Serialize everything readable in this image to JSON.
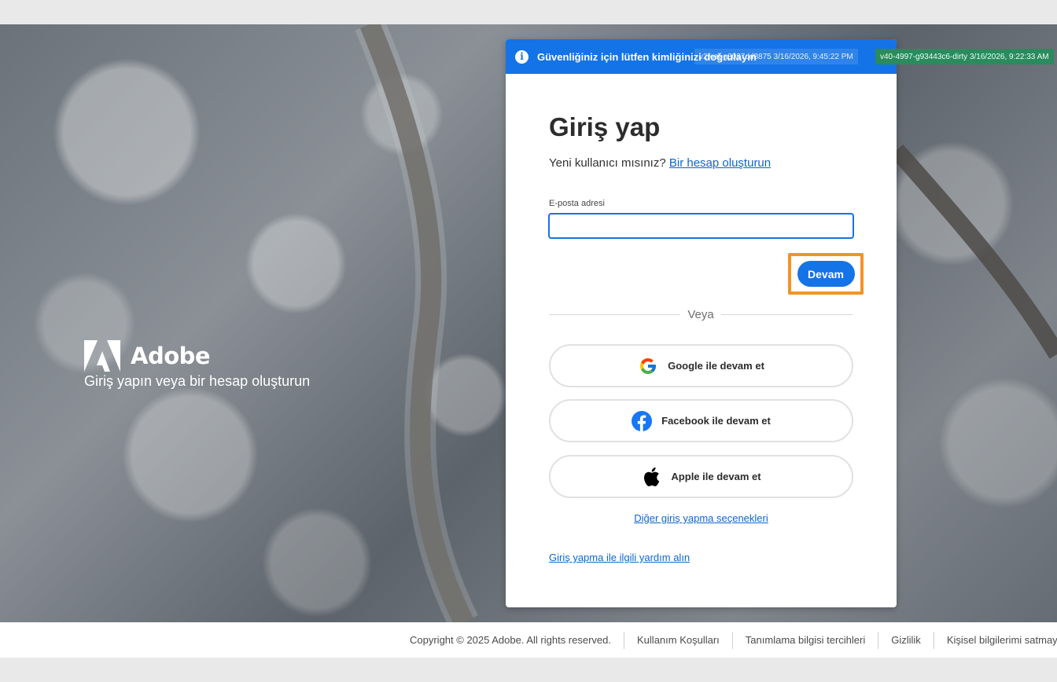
{
  "banner": {
    "text": "Güvenliğiniz için lütfen kimliğinizi doğrulayın",
    "version_a": "v2rozt-g3037dd8875 3/16/2026, 9:45:22 PM",
    "version_b": "v40-4997-g93443c6-dirty 3/16/2026, 9:22:33 AM",
    "color": "#1473e6"
  },
  "brand": {
    "name": "Adobe",
    "tagline": "Giriş yapın veya bir hesap oluşturun",
    "logo_icon": "adobe-logo-icon"
  },
  "form": {
    "title": "Giriş yap",
    "new_user_text": "Yeni kullanıcı mısınız?",
    "create_account_link": "Bir hesap oluşturun",
    "email_label": "E-posta adresi",
    "email_value": "",
    "continue_label": "Devam",
    "or_text": "Veya",
    "accent_color": "#1473e6",
    "highlight_color": "#f29423"
  },
  "social": {
    "google": "Google ile devam et",
    "facebook": "Facebook ile devam et",
    "apple": "Apple ile devam et"
  },
  "links": {
    "other_options": "Diğer giriş yapma seçenekleri",
    "help": "Giriş yapma ile ilgili yardım alın"
  },
  "footer": {
    "copyright": "Copyright © 2025 Adobe. All rights reserved.",
    "terms": "Kullanım Koşulları",
    "cookies": "Tanımlama bilgisi tercihleri",
    "privacy": "Gizlilik",
    "do_not_sell": "Kişisel bilgilerimi satmayın veya paylaşmayın"
  }
}
